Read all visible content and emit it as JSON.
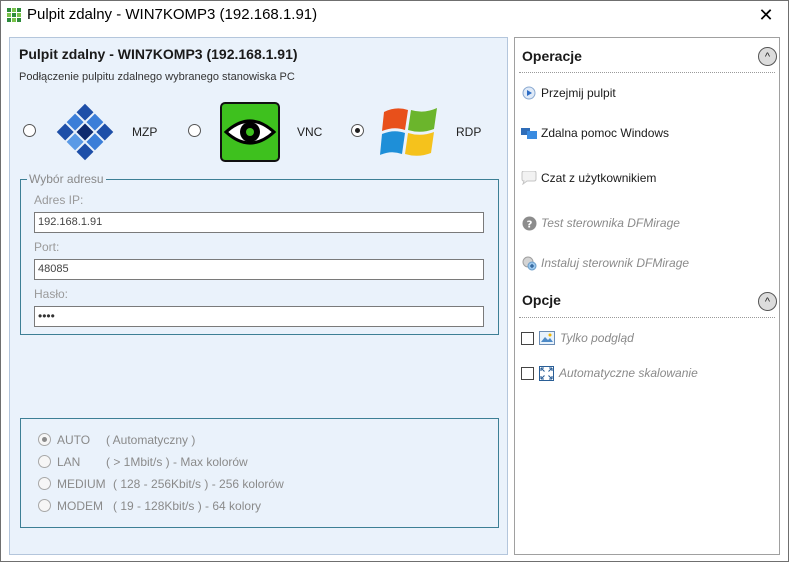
{
  "window": {
    "title": "Pulpit zdalny - WIN7KOMP3 (192.168.1.91)",
    "close_glyph": "✕"
  },
  "left": {
    "title": "Pulpit zdalny - WIN7KOMP3 (192.168.1.91)",
    "subtitle": "Podłączenie pulpitu zdalnego wybranego stanowiska PC",
    "connection_types": [
      {
        "label": "MZP",
        "selected": false,
        "icon": "mzp-logo-icon"
      },
      {
        "label": "VNC",
        "selected": false,
        "icon": "eye-icon"
      },
      {
        "label": "RDP",
        "selected": true,
        "icon": "windows-logo-icon"
      }
    ],
    "address": {
      "legend": "Wybór adresu",
      "ip_label": "Adres IP:",
      "ip_value": "192.168.1.91",
      "port_label": "Port:",
      "port_value": "48085",
      "password_label": "Hasło:",
      "password_value": "••••"
    },
    "quality": [
      {
        "label": "AUTO",
        "desc": "( Automatyczny )",
        "selected": true
      },
      {
        "label": "LAN",
        "desc": "( > 1Mbit/s ) - Max kolorów",
        "selected": false
      },
      {
        "label": "MEDIUM",
        "desc": "( 128 - 256Kbit/s ) - 256 kolorów",
        "selected": false
      },
      {
        "label": "MODEM",
        "desc": "( 19 - 128Kbit/s ) - 64 kolory",
        "selected": false
      }
    ]
  },
  "right": {
    "operations_title": "Operacje",
    "actions": [
      {
        "label": "Przejmij pulpit",
        "icon": "play-icon",
        "enabled": true
      },
      {
        "label": "Zdalna pomoc Windows",
        "icon": "remote-help-icon",
        "enabled": true
      },
      {
        "label": "Czat z użytkownikiem",
        "icon": "chat-bubble-icon",
        "enabled": true
      },
      {
        "label": "Test sterownika DFMirage",
        "icon": "help-icon",
        "enabled": false
      },
      {
        "label": "Instaluj sterownik DFMirage",
        "icon": "install-driver-icon",
        "enabled": false
      }
    ],
    "options_title": "Opcje",
    "options": [
      {
        "label": "Tylko podgląd",
        "icon": "preview-image-icon",
        "checked": false
      },
      {
        "label": "Automatyczne skalowanie",
        "icon": "scale-icon",
        "checked": false
      }
    ],
    "collapse_glyph": "^"
  },
  "colors": {
    "panel_bg": "#eaf2fb",
    "fieldset_border": "#3d7f95",
    "vnc_green": "#3ec11e"
  }
}
